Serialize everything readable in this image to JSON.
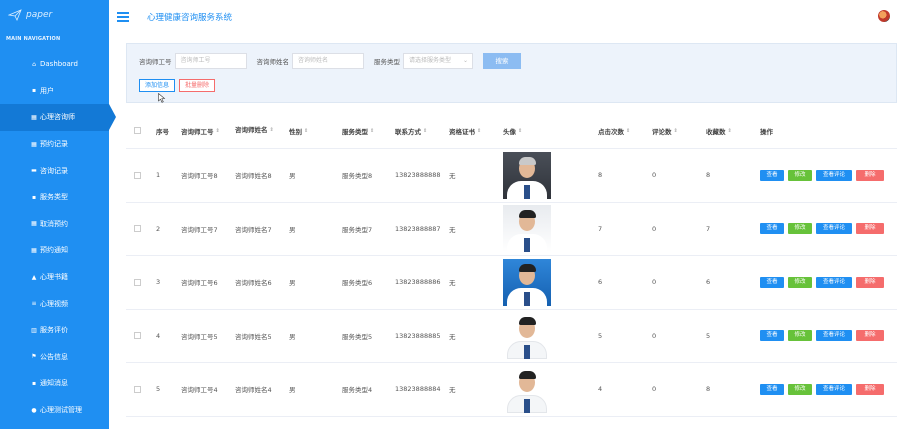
{
  "sidebar": {
    "logo_text": "paper",
    "nav_header": "MAIN NAVIGATION",
    "items": [
      {
        "label": "Dashboard",
        "icon": "home-icon",
        "glyph": "⌂"
      },
      {
        "label": "用户",
        "icon": "user-group-icon",
        "glyph": "▪"
      },
      {
        "label": "心理咨询师",
        "icon": "grid-icon",
        "glyph": "▦",
        "active": true
      },
      {
        "label": "预约记录",
        "icon": "grid-icon",
        "glyph": "▦"
      },
      {
        "label": "咨询记录",
        "icon": "chat-icon",
        "glyph": "▬"
      },
      {
        "label": "服务类型",
        "icon": "list-icon",
        "glyph": "▪"
      },
      {
        "label": "取消预约",
        "icon": "grid-icon",
        "glyph": "▦"
      },
      {
        "label": "预约通知",
        "icon": "grid-icon",
        "glyph": "▦"
      },
      {
        "label": "心理书籍",
        "icon": "person-icon",
        "glyph": "▲"
      },
      {
        "label": "心理视频",
        "icon": "filter-icon",
        "glyph": "≡"
      },
      {
        "label": "服务评价",
        "icon": "bar-chart-icon",
        "glyph": "▥"
      },
      {
        "label": "公告信息",
        "icon": "flag-icon",
        "glyph": "⚑"
      },
      {
        "label": "通知消息",
        "icon": "notice-icon",
        "glyph": "▪"
      },
      {
        "label": "心理测试管理",
        "icon": "bulb-icon",
        "glyph": "●"
      }
    ]
  },
  "topbar": {
    "title": "心理健康咨询服务系统"
  },
  "search": {
    "field1_label": "咨询师工号",
    "field1_placeholder": "咨询师工号",
    "field2_label": "咨询师姓名",
    "field2_placeholder": "咨询师姓名",
    "field3_label": "服务类型",
    "field3_placeholder": "请选择服务类型",
    "search_button": "搜索",
    "add_button": "添加信息",
    "batch_delete_button": "批量删除"
  },
  "table": {
    "headers": [
      "序号",
      "咨询师工号",
      "咨询师姓名",
      "性别",
      "服务类型",
      "联系方式",
      "资格证书",
      "头像",
      "点击次数",
      "评论数",
      "收藏数",
      "操作"
    ],
    "rows": [
      {
        "index": "1",
        "job_no": "咨询师工号8",
        "name": "咨询师姓名8",
        "gender": "男",
        "service": "服务类型8",
        "phone": "13823888888",
        "cert": "无",
        "photo": "photo-dark-gray-hair",
        "clicks": "8",
        "comments": "0",
        "favorites": "8"
      },
      {
        "index": "2",
        "job_no": "咨询师工号7",
        "name": "咨询师姓名7",
        "gender": "男",
        "service": "服务类型7",
        "phone": "13823888887",
        "cert": "无",
        "photo": "photo-light",
        "clicks": "7",
        "comments": "0",
        "favorites": "7"
      },
      {
        "index": "3",
        "job_no": "咨询师工号6",
        "name": "咨询师姓名6",
        "gender": "男",
        "service": "服务类型6",
        "phone": "13823888886",
        "cert": "无",
        "photo": "photo-blue",
        "clicks": "6",
        "comments": "0",
        "favorites": "6"
      },
      {
        "index": "4",
        "job_no": "咨询师工号5",
        "name": "咨询师姓名5",
        "gender": "男",
        "service": "服务类型5",
        "phone": "13823888885",
        "cert": "无",
        "photo": "photo-white",
        "clicks": "5",
        "comments": "0",
        "favorites": "5"
      },
      {
        "index": "5",
        "job_no": "咨询师工号4",
        "name": "咨询师姓名4",
        "gender": "男",
        "service": "服务类型4",
        "phone": "13823888884",
        "cert": "无",
        "photo": "photo-white",
        "clicks": "4",
        "comments": "0",
        "favorites": "8"
      }
    ],
    "actions": {
      "view": "查看",
      "edit": "修改",
      "reviews": "查看评论",
      "delete": "删除"
    }
  },
  "colors": {
    "sidebar_bg": "#1f8ff2",
    "sidebar_active": "#1379d6",
    "primary": "#1f8ff2",
    "success": "#67c23a",
    "danger": "#f56c6c"
  }
}
